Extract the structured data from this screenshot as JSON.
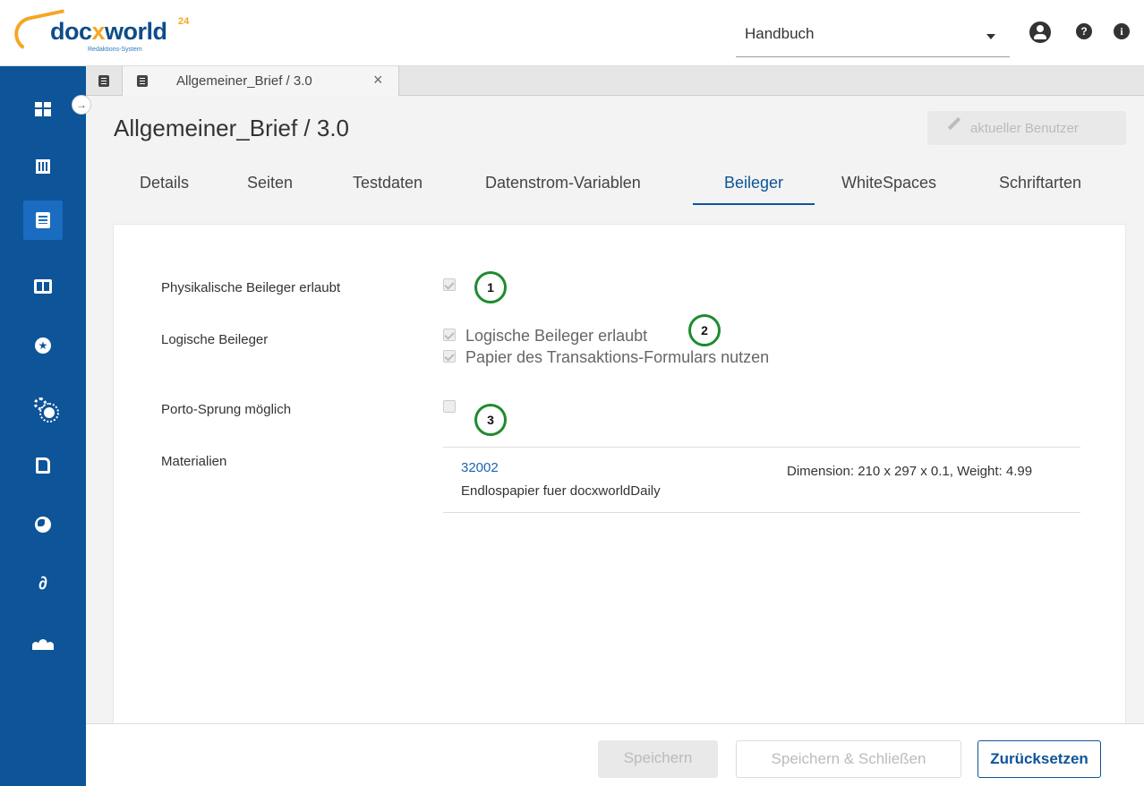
{
  "app": {
    "logo_text": "docxworld",
    "logo_sup": "24",
    "logo_sub": "Redaktions-System"
  },
  "header": {
    "project_select": "Handbuch",
    "icons": [
      "user-circle-icon",
      "help-icon",
      "info-icon"
    ]
  },
  "sidebar": {
    "items": [
      {
        "icon": "dashboard-icon"
      },
      {
        "icon": "building-icon"
      },
      {
        "icon": "document-icon",
        "active": true
      },
      {
        "icon": "book-icon"
      },
      {
        "icon": "star-icon"
      },
      {
        "icon": "cogs-icon"
      },
      {
        "icon": "file-icon"
      },
      {
        "icon": "globe-icon"
      },
      {
        "icon": "link-icon"
      },
      {
        "icon": "users-icon"
      }
    ],
    "expand_glyph": "→"
  },
  "doc_tab": {
    "label": "Allgemeiner_Brief / 3.0",
    "close": "×"
  },
  "page": {
    "title": "Allgemeiner_Brief / 3.0",
    "user_button": "aktueller Benutzer"
  },
  "tabs": [
    {
      "label": "Details"
    },
    {
      "label": "Seiten"
    },
    {
      "label": "Testdaten"
    },
    {
      "label": "Datenstrom-Variablen"
    },
    {
      "label": "Beileger",
      "active": true
    },
    {
      "label": "WhiteSpaces"
    },
    {
      "label": "Schriftarten"
    }
  ],
  "form": {
    "physical_label": "Physikalische Beileger erlaubt",
    "physical_checked": true,
    "logical_label": "Logische Beileger",
    "logical_option1": "Logische Beileger erlaubt",
    "logical_option1_checked": true,
    "logical_option2": "Papier des Transaktions-Formulars nutzen",
    "logical_option2_checked": true,
    "porto_label": "Porto-Sprung möglich",
    "porto_checked": false,
    "materials_label": "Materialien",
    "badges": [
      "1",
      "2",
      "3"
    ]
  },
  "materials": [
    {
      "id": "32002",
      "name": "Endlospapier fuer docxworldDaily",
      "dimension": "Dimension: 210 x 297 x 0.1, Weight: 4.99"
    }
  ],
  "footer": {
    "save": "Speichern",
    "save_close": "Speichern & Schließen",
    "reset": "Zurücksetzen"
  },
  "colors": {
    "primary": "#0d5499",
    "sidebar_active": "#1a6cc0",
    "badge_border": "#1e8b2e",
    "logo_orange": "#f5a623"
  }
}
